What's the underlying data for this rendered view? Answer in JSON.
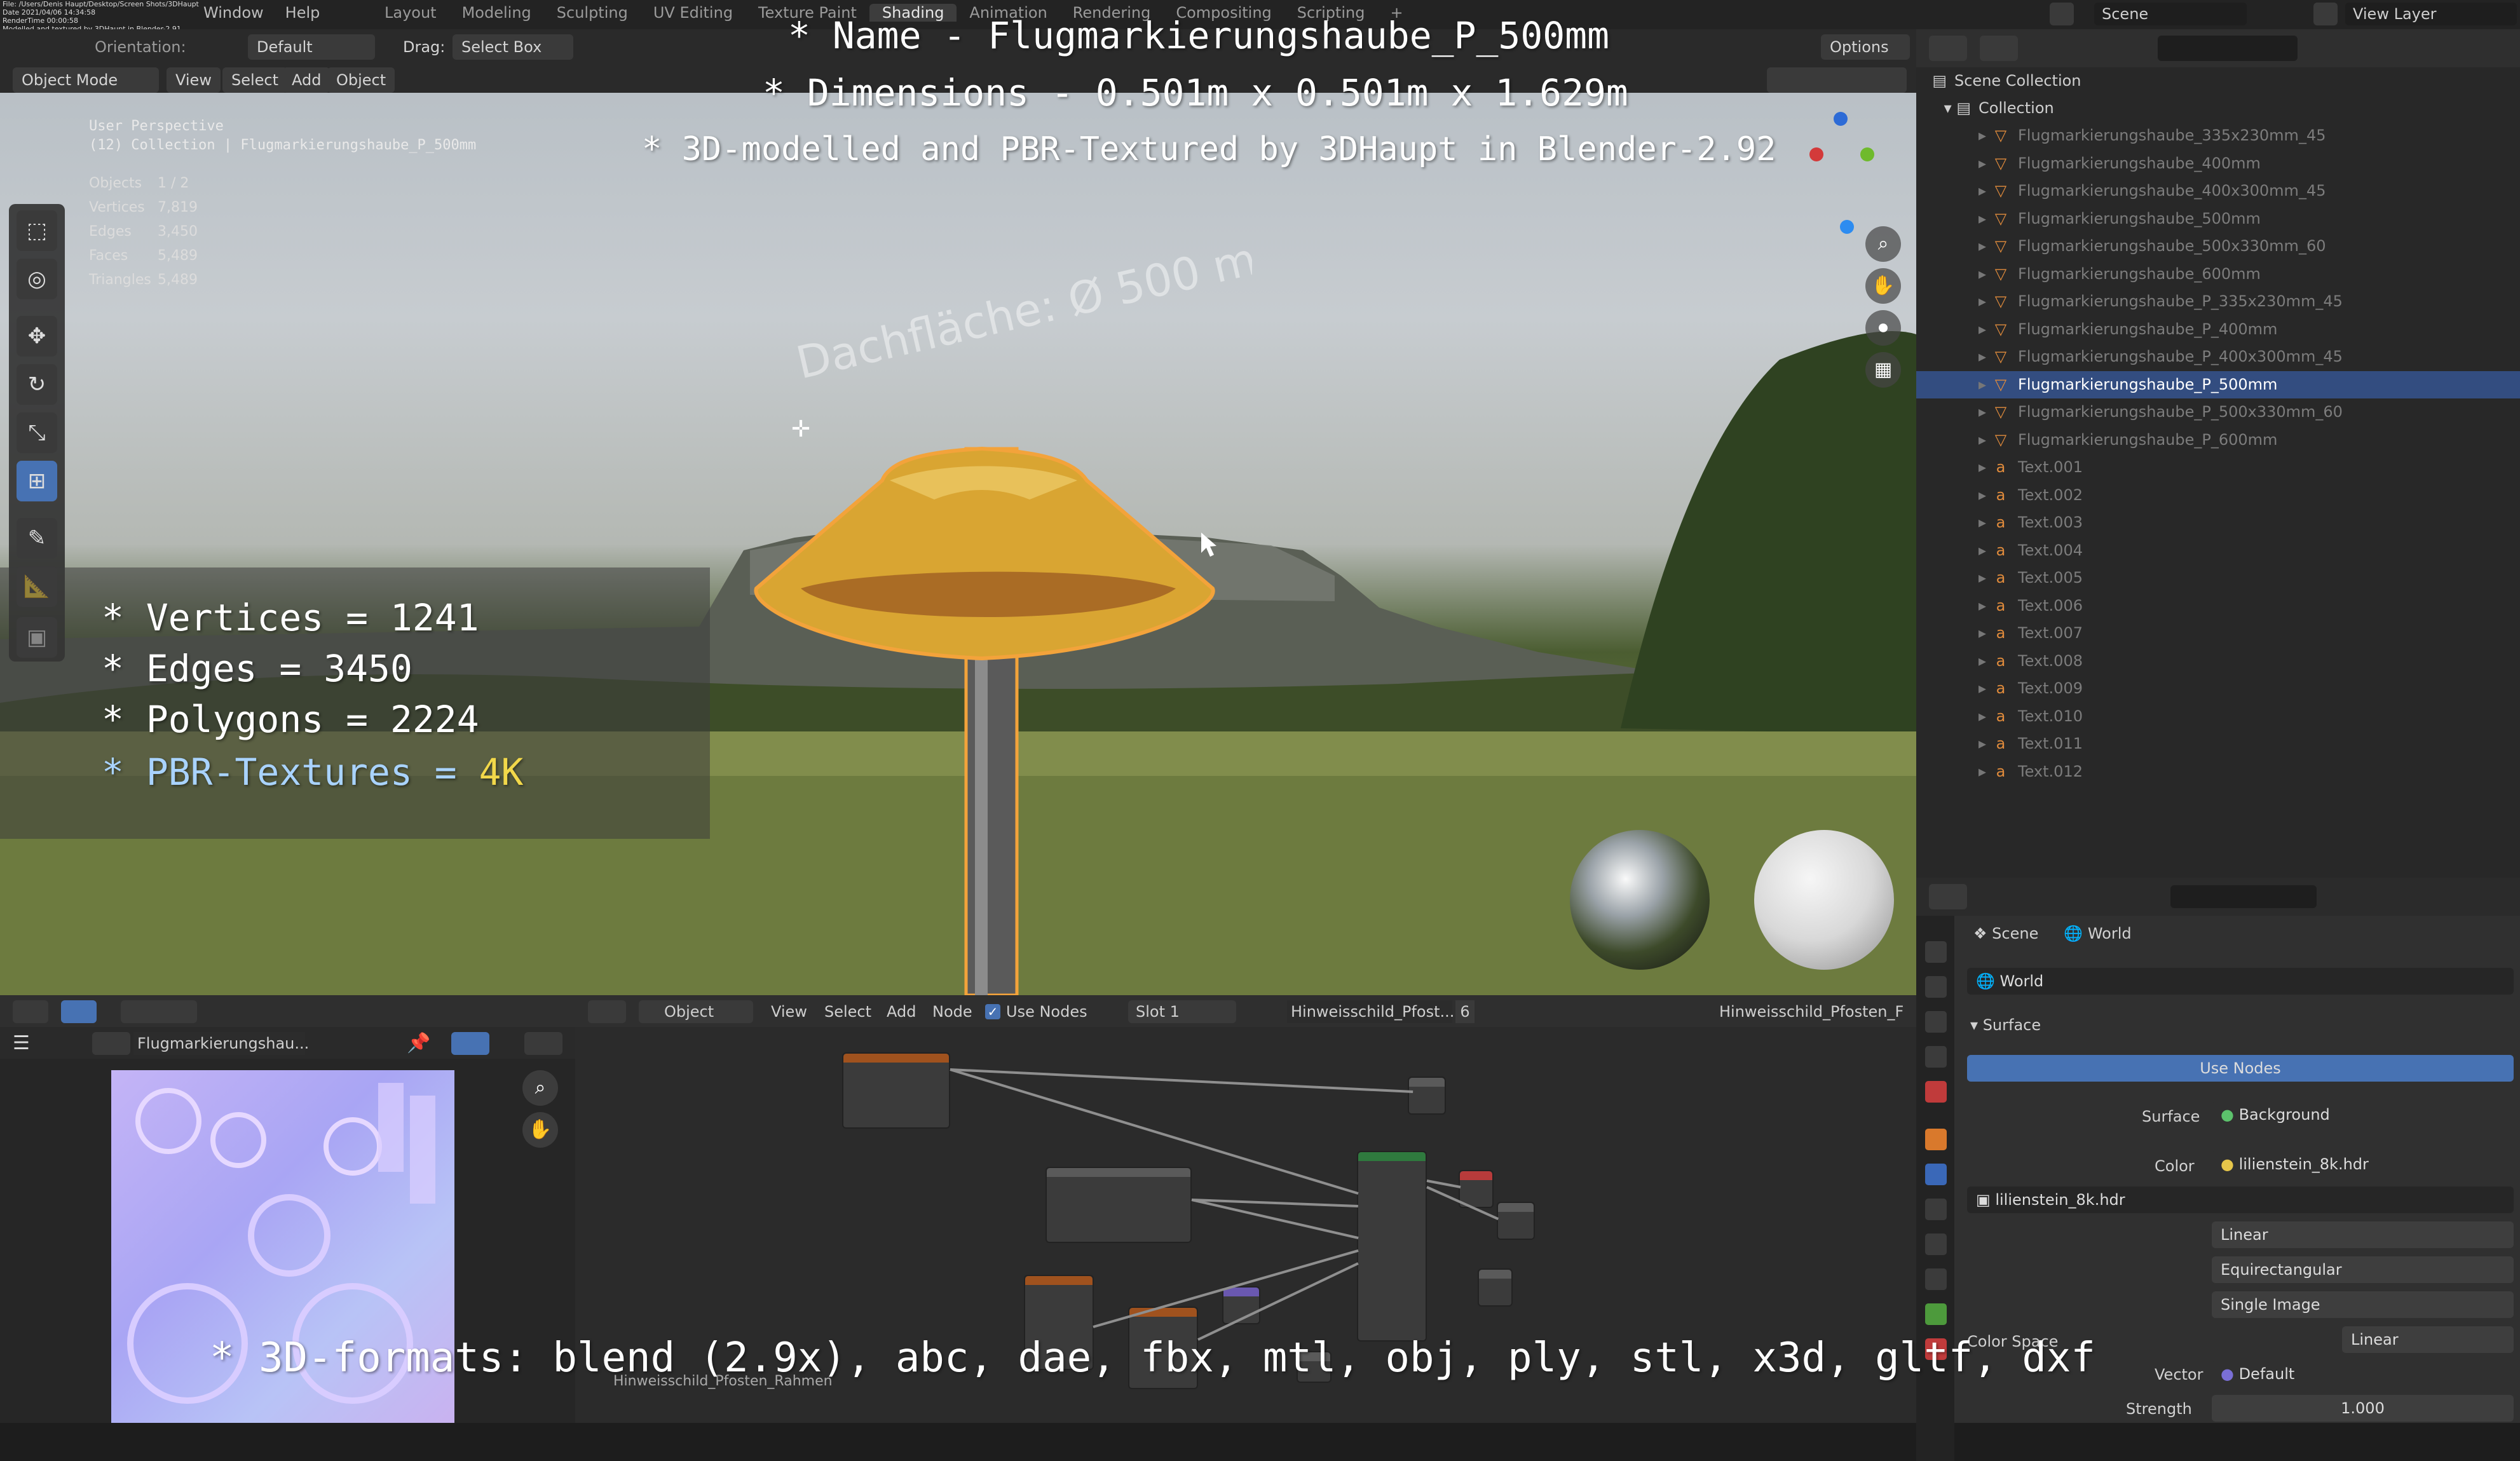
{
  "topbar": {
    "menu": [
      "Window",
      "Help"
    ],
    "workspaces": [
      "Layout",
      "Modeling",
      "Sculpting",
      "UV Editing",
      "Texture Paint",
      "Shading",
      "Animation",
      "Rendering",
      "Compositing",
      "Scripting"
    ],
    "active_workspace": "Shading",
    "scene_label": "Scene",
    "view_layer_label": "View Layer",
    "file_info": [
      "File: /Users/Denis Haupt/Desktop/Screen Shots/3DHaupt",
      "Date 2021/04/06 14:34:58",
      "RenderTime 00:00:58",
      "Modelled and textured by 3DHaupt in Blender-2.91"
    ]
  },
  "header": {
    "orientation_label": "Orientation:",
    "orientation_value": "Default",
    "drag_label": "Drag:",
    "drag_value": "Select Box",
    "options_label": "Options",
    "mode": "Object Mode",
    "view": "View",
    "select": "Select",
    "add": "Add",
    "object": "Object"
  },
  "viewport": {
    "perspective": "User Perspective",
    "collection_path": "(12) Collection | Flugmarkierungshaube_P_500mm",
    "stats": [
      {
        "label": "Objects",
        "value": "1 / 2"
      },
      {
        "label": "Vertices",
        "value": "7,819"
      },
      {
        "label": "Edges",
        "value": "3,450"
      },
      {
        "label": "Faces",
        "value": "5,489"
      },
      {
        "label": "Triangles",
        "value": "5,489"
      }
    ],
    "scene_text": "Dachfläche:  Ø 500 mm"
  },
  "overlay": {
    "name_line": "* Name - Flugmarkierungshaube_P_500mm",
    "dims_line": "* Dimensions -  0.501m x 0.501m x 1.629m",
    "credit_line": "* 3D-modelled and PBR-Textured by 3DHaupt in Blender-2.92",
    "vertices_line": "* Vertices = 1241",
    "edges_line": "* Edges = 3450",
    "polygons_line": "* Polygons = 2224",
    "pbr_prefix": "* PBR-Textures = ",
    "pbr_value": "4K",
    "formats_line": "* 3D-formats: blend (2.9x), abc, dae, fbx, mtl, obj, ply, stl, x3d, gltf, dxf"
  },
  "outliner": {
    "root": "Scene Collection",
    "collection": "Collection",
    "items": [
      {
        "name": "Flugmarkierungshaube_335x230mm_45",
        "type": "mesh"
      },
      {
        "name": "Flugmarkierungshaube_400mm",
        "type": "mesh"
      },
      {
        "name": "Flugmarkierungshaube_400x300mm_45",
        "type": "mesh"
      },
      {
        "name": "Flugmarkierungshaube_500mm",
        "type": "mesh"
      },
      {
        "name": "Flugmarkierungshaube_500x330mm_60",
        "type": "mesh"
      },
      {
        "name": "Flugmarkierungshaube_600mm",
        "type": "mesh"
      },
      {
        "name": "Flugmarkierungshaube_P_335x230mm_45",
        "type": "mesh"
      },
      {
        "name": "Flugmarkierungshaube_P_400mm",
        "type": "mesh"
      },
      {
        "name": "Flugmarkierungshaube_P_400x300mm_45",
        "type": "mesh"
      },
      {
        "name": "Flugmarkierungshaube_P_500mm",
        "type": "mesh",
        "selected": true
      },
      {
        "name": "Flugmarkierungshaube_P_500x330mm_60",
        "type": "mesh"
      },
      {
        "name": "Flugmarkierungshaube_P_600mm",
        "type": "mesh"
      },
      {
        "name": "Text.001",
        "type": "text"
      },
      {
        "name": "Text.002",
        "type": "text"
      },
      {
        "name": "Text.003",
        "type": "text"
      },
      {
        "name": "Text.004",
        "type": "text"
      },
      {
        "name": "Text.005",
        "type": "text"
      },
      {
        "name": "Text.006",
        "type": "text"
      },
      {
        "name": "Text.007",
        "type": "text"
      },
      {
        "name": "Text.008",
        "type": "text"
      },
      {
        "name": "Text.009",
        "type": "text"
      },
      {
        "name": "Text.010",
        "type": "text"
      },
      {
        "name": "Text.011",
        "type": "text"
      },
      {
        "name": "Text.012",
        "type": "text"
      }
    ]
  },
  "properties": {
    "breadcrumb_scene": "Scene",
    "breadcrumb_world": "World",
    "world_name": "World",
    "surface_header": "Surface",
    "use_nodes_button": "Use Nodes",
    "surface_label": "Surface",
    "surface_value": "Background",
    "color_label": "Color",
    "color_value": "lilienstein_8k.hdr",
    "image_name": "lilienstein_8k.hdr",
    "interpolation": "Linear",
    "projection": "Equirectangular",
    "source": "Single Image",
    "color_space_label": "Color Space",
    "color_space_value": "Linear",
    "vector_label": "Vector",
    "vector_value": "Default",
    "strength_label": "Strength",
    "strength_value": "1.000"
  },
  "image_editor": {
    "image_name": "Flugmarkierungshau..."
  },
  "node_editor": {
    "object_label": "Object",
    "view": "View",
    "select": "Select",
    "add": "Add",
    "node": "Node",
    "use_nodes": "Use Nodes",
    "slot": "Slot 1",
    "material": "Hinweisschild_Pfost...",
    "user_count": "6",
    "material_path": "Hinweisschild_Pfosten_F",
    "frame_label": "Hinweisschild_Pfosten_Rahmen"
  }
}
